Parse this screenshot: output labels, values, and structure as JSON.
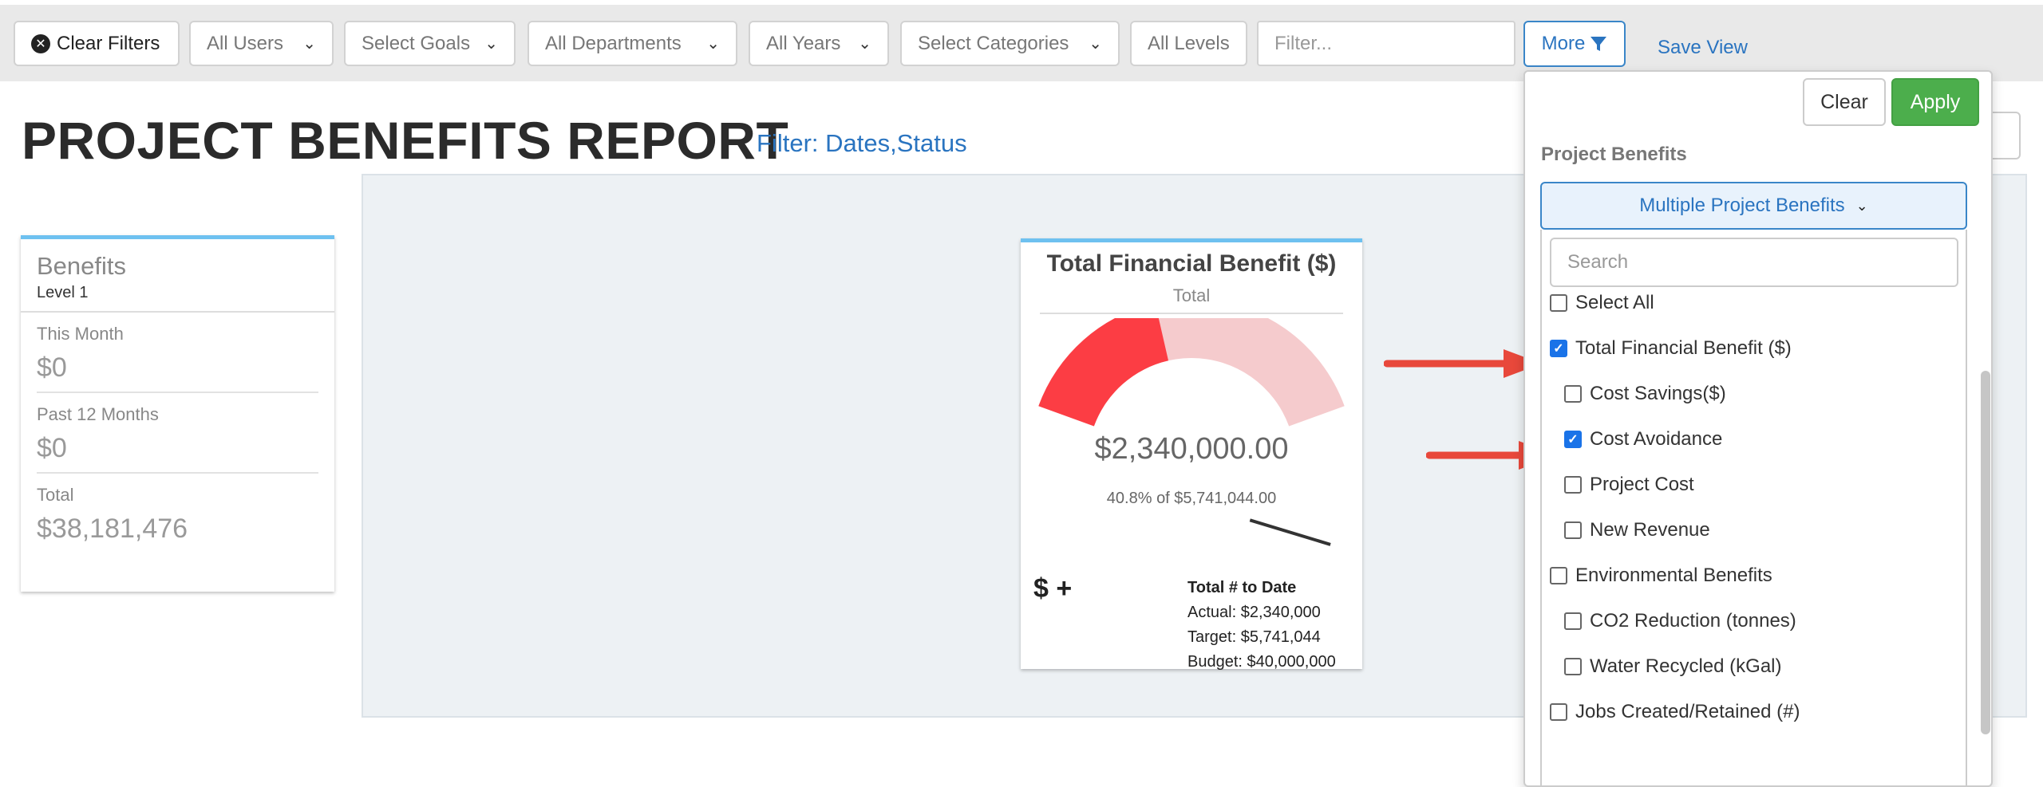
{
  "filters": {
    "clear_label": "Clear Filters",
    "users": "All Users",
    "goals": "Select Goals",
    "departments": "All Departments",
    "years": "All Years",
    "categories": "Select Categories",
    "levels": "All Levels",
    "search_placeholder": "Filter...",
    "more_label": "More",
    "save_view": "Save View"
  },
  "report": {
    "title": "PROJECT BENEFITS REPORT",
    "filter_note": "Filter: Dates,Status"
  },
  "stats": {
    "title": "Benefits",
    "subtitle": "Level 1",
    "rows": [
      {
        "label": "This Month",
        "value": "$0"
      },
      {
        "label": "Past 12 Months",
        "value": "$0"
      },
      {
        "label": "Total",
        "value": "$38,181,476"
      }
    ]
  },
  "gauge": {
    "title": "Total Financial Benefit ($)",
    "subtitle": "Total",
    "center_value": "$2,340,000.00",
    "percent_text": "40.8% of $5,741,044.00",
    "fraction": 0.408,
    "symbol": "$ +",
    "totals_heading": "Total # to Date",
    "actual": "Actual: $2,340,000",
    "target": "Target: $5,741,044",
    "budget": "Budget: $40,000,000",
    "colors": {
      "fill": "#fc3d44",
      "track": "#f5cbcd",
      "needle": "#333333"
    }
  },
  "popup": {
    "clear_label": "Clear",
    "apply_label": "Apply",
    "section_label": "Project Benefits",
    "select_value": "Multiple Project Benefits",
    "search_placeholder": "Search",
    "options": [
      {
        "label": "Select All",
        "checked": false,
        "indent": 0
      },
      {
        "label": "Total Financial Benefit ($)",
        "checked": true,
        "indent": 0
      },
      {
        "label": "Cost Savings($)",
        "checked": false,
        "indent": 1
      },
      {
        "label": "Cost Avoidance",
        "checked": true,
        "indent": 1
      },
      {
        "label": "Project Cost",
        "checked": false,
        "indent": 1
      },
      {
        "label": "New Revenue",
        "checked": false,
        "indent": 1
      },
      {
        "label": "Environmental Benefits",
        "checked": false,
        "indent": 0
      },
      {
        "label": "CO2 Reduction (tonnes)",
        "checked": false,
        "indent": 1
      },
      {
        "label": "Water Recycled (kGal)",
        "checked": false,
        "indent": 1
      },
      {
        "label": "Jobs Created/Retained (#)",
        "checked": false,
        "indent": 0
      }
    ]
  },
  "colors": {
    "accent": "#2a74c0",
    "apply": "#4cae4c",
    "card_border": "#6ec1f0",
    "arrow": "#e8483b"
  }
}
